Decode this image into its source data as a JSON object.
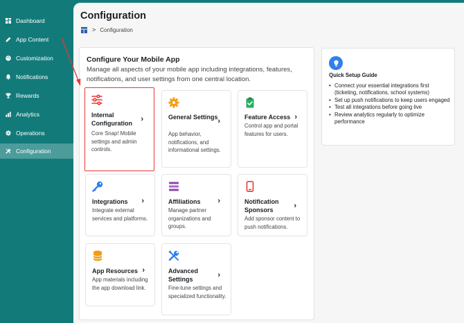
{
  "sidebar": {
    "items": [
      {
        "label": "Dashboard",
        "icon": "dashboard-icon"
      },
      {
        "label": "App Content",
        "icon": "edit-icon"
      },
      {
        "label": "Customization",
        "icon": "palette-icon"
      },
      {
        "label": "Notifications",
        "icon": "bell-icon"
      },
      {
        "label": "Rewards",
        "icon": "trophy-icon"
      },
      {
        "label": "Analytics",
        "icon": "bar-chart-icon"
      },
      {
        "label": "Operations",
        "icon": "gear-icon"
      },
      {
        "label": "Configuration",
        "icon": "wrench-icon",
        "active": true
      }
    ]
  },
  "page": {
    "title": "Configuration",
    "breadcrumb": {
      "current": "Configuration",
      "separator": ">"
    }
  },
  "config": {
    "title": "Configure Your Mobile App",
    "description": "Manage all aspects of your mobile app including integrations, features, notifications, and user settings from one central location.",
    "tiles": [
      {
        "title": "Internal Configuration",
        "description": "Core Snap! Mobile settings and admin controls.",
        "icon": "sliders-icon",
        "color": "#e53935",
        "highlighted": true
      },
      {
        "title": "General Settings",
        "description": "App behavior, notifications, and informational settings.",
        "icon": "gear-icon",
        "color": "#f39c12"
      },
      {
        "title": "Feature Access",
        "description": "Control app and portal features for users.",
        "icon": "clipboard-check-icon",
        "color": "#27ae60"
      },
      {
        "title": "Integrations",
        "description": "Integrate external services and platforms.",
        "icon": "key-icon",
        "color": "#2f80ed"
      },
      {
        "title": "Affiliations",
        "description": "Manage partner organizations and groups.",
        "icon": "layers-icon",
        "color": "#8e44ad"
      },
      {
        "title": "Notification Sponsors",
        "description": "Add sponsor content to push notifications.",
        "icon": "phone-icon",
        "color": "#e53935"
      },
      {
        "title": "App Resources",
        "description": "App materials including the app download link.",
        "icon": "database-icon",
        "color": "#f39c12"
      },
      {
        "title": "Advanced Settings",
        "description": "Fine-tune settings and specialized functionality.",
        "icon": "tools-icon",
        "color": "#2f80ed"
      }
    ]
  },
  "quick_setup": {
    "title": "Quick Setup Guide",
    "icon": "lightbulb-icon",
    "items": [
      "Connect your essential integrations first (ticketing, notifications, school systems)",
      "Set up push notifications to keep users engaged",
      "Test all integrations before going live",
      "Review analytics regularly to optimize performance"
    ]
  },
  "colors": {
    "sidebar_bg": "#127b7a",
    "sidebar_active": "#4c9c9b",
    "annotation": "#e53935",
    "accent_blue": "#2f80ed"
  }
}
